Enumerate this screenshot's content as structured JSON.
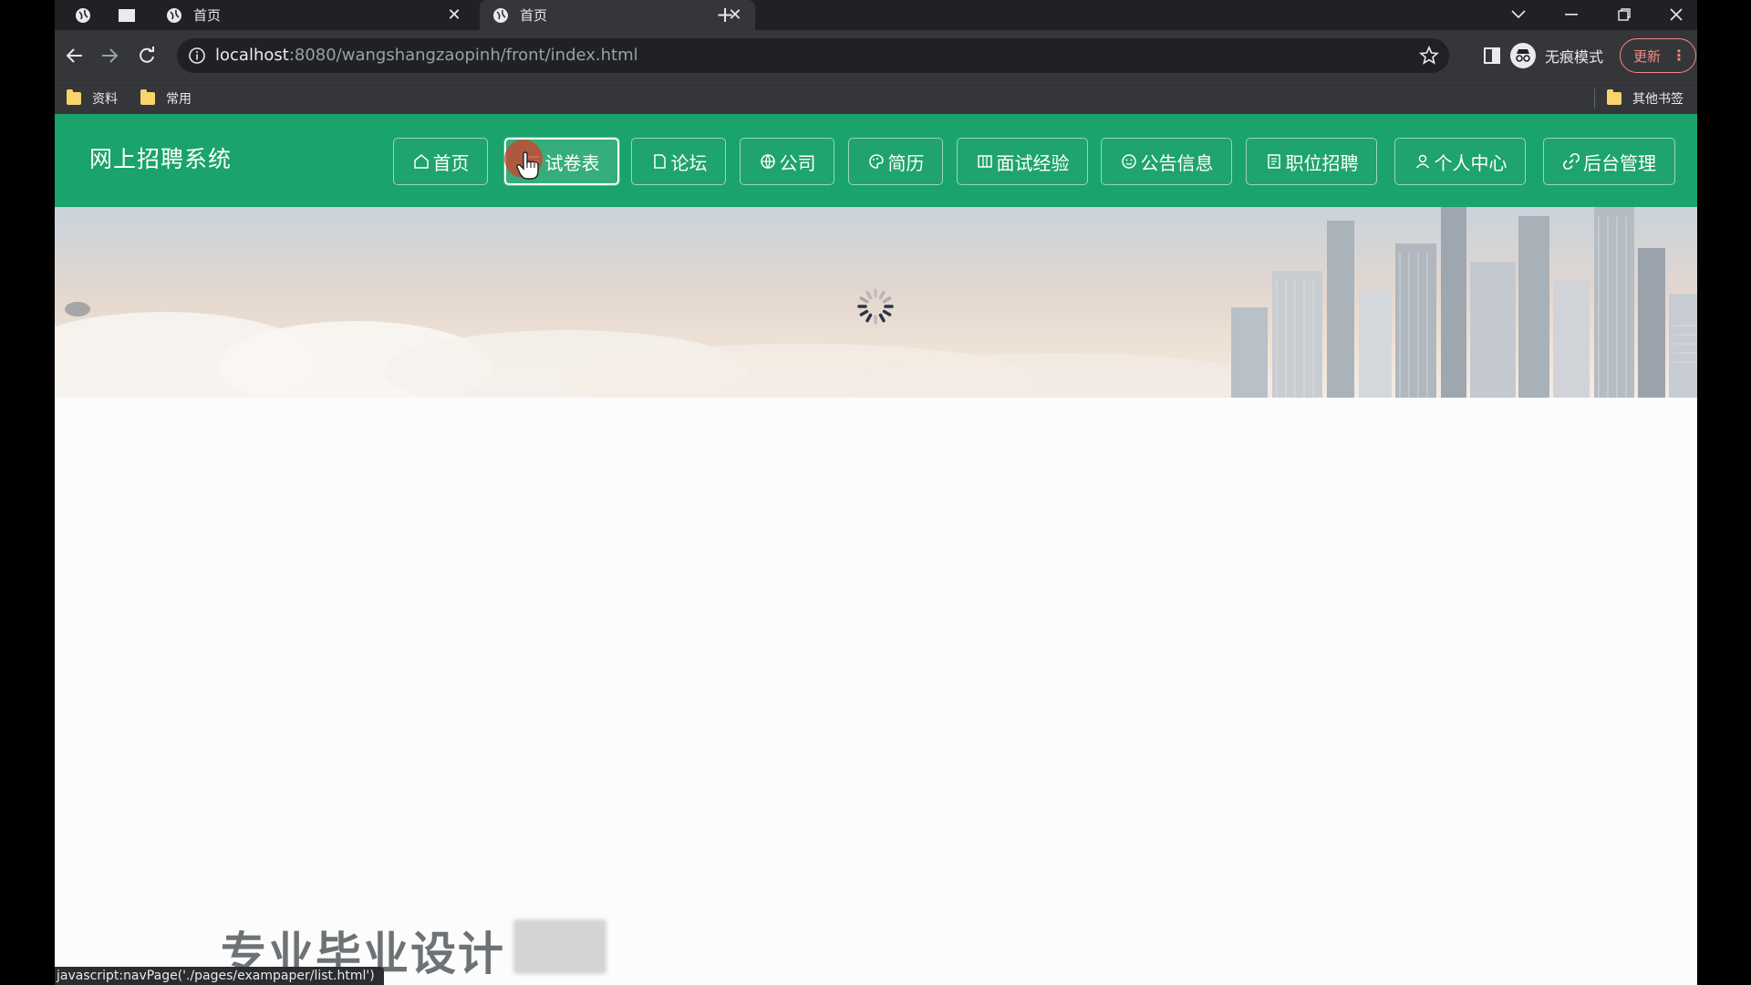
{
  "browser": {
    "tabs": [
      {
        "title": "首页",
        "active": false
      },
      {
        "title": "首页",
        "active": true
      }
    ],
    "new_tab_label": "+",
    "address": {
      "host": "localhost",
      "rest": ":8080/wangshangzaopinh/front/index.html"
    },
    "incognito_label": "无痕模式",
    "update_label": "更新",
    "bookmarks": [
      {
        "label": "资料"
      },
      {
        "label": "常用"
      }
    ],
    "other_bookmarks_label": "其他书签",
    "status_url": "javascript:navPage('./pages/exampaper/list.html')"
  },
  "site": {
    "title": "网上招聘系统",
    "nav": [
      {
        "label": "首页",
        "icon": "home-icon",
        "active": false
      },
      {
        "label": "试卷表",
        "icon": "list-icon",
        "active": true
      },
      {
        "label": "论坛",
        "icon": "document-icon",
        "active": false
      },
      {
        "label": "公司",
        "icon": "globe-icon",
        "active": false
      },
      {
        "label": "简历",
        "icon": "palette-icon",
        "active": false
      },
      {
        "label": "面试经验",
        "icon": "grid-icon",
        "active": false
      },
      {
        "label": "公告信息",
        "icon": "smile-icon",
        "active": false
      },
      {
        "label": "职位招聘",
        "icon": "file-icon",
        "active": false
      },
      {
        "label": "个人中心",
        "icon": "user-icon",
        "active": false
      },
      {
        "label": "后台管理",
        "icon": "link-icon",
        "active": false
      }
    ],
    "promo_text": "专业毕业设计",
    "accent_color": "#1aa36a"
  }
}
